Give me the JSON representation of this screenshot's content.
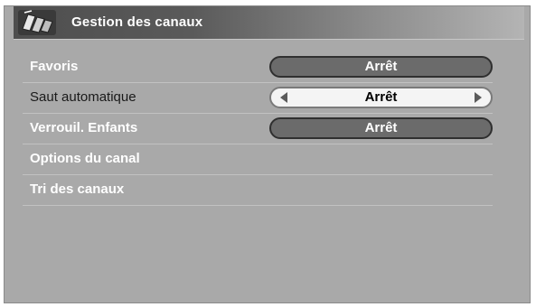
{
  "header": {
    "title": "Gestion des canaux",
    "icon": "channel-management-icon"
  },
  "menu": {
    "items": [
      {
        "label": "Favoris",
        "value": "Arrêt"
      },
      {
        "label": "Saut automatique",
        "value": "Arrêt"
      },
      {
        "label": "Verrouil. Enfants",
        "value": "Arrêt"
      },
      {
        "label": "Options du canal"
      },
      {
        "label": "Tri des canaux"
      }
    ]
  },
  "colors": {
    "background": "#a9a9a9",
    "title_bar_dark": "#4e4e4e",
    "pill_inactive": "#6b6b6b",
    "pill_active": "#f4f4f4"
  }
}
